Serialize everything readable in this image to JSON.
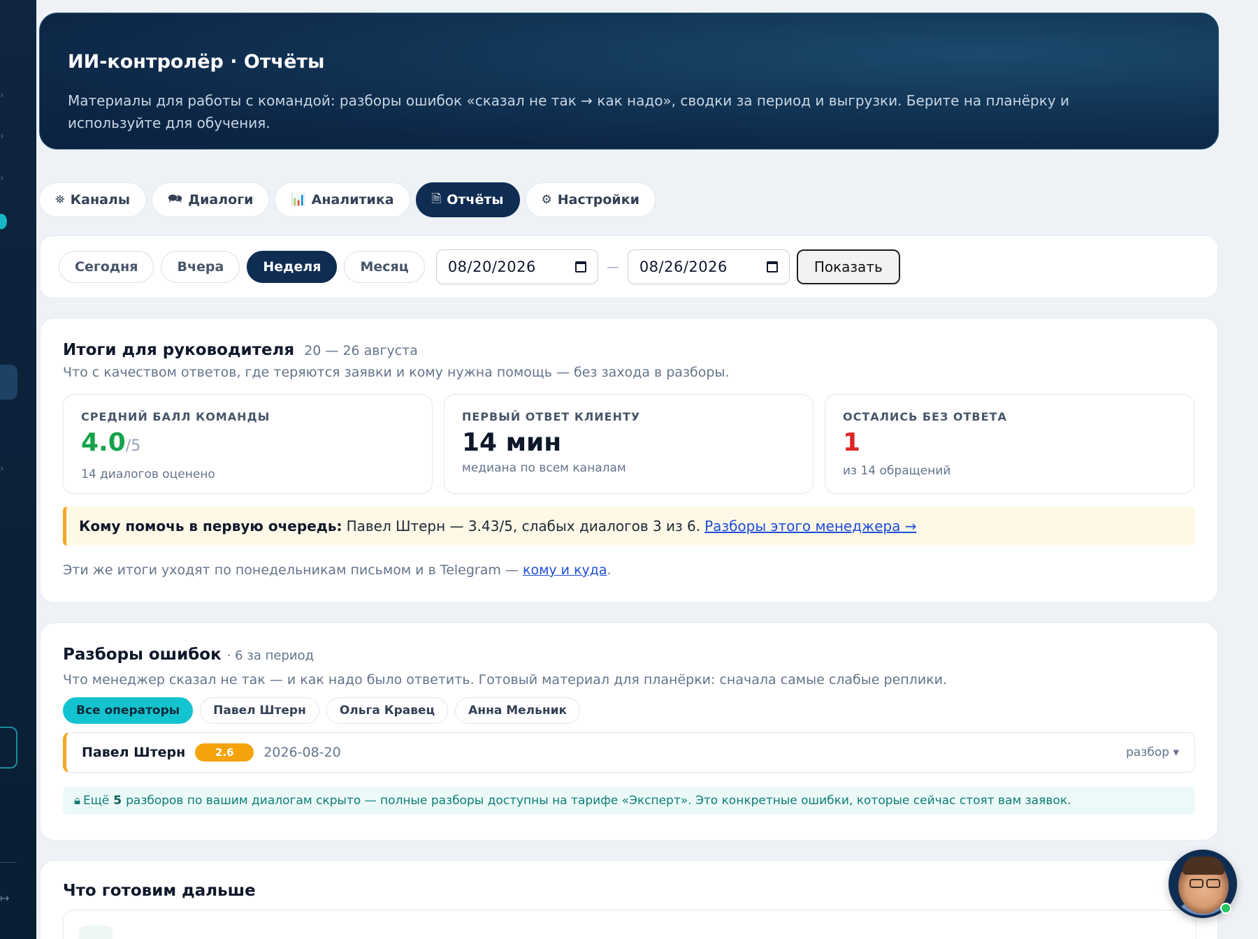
{
  "hero": {
    "title": "ИИ-контролёр · Отчёты",
    "description": "Материалы для работы с командой: разборы ошибок «сказал не так → как надо», сводки за период и выгрузки. Берите на планёрку и используйте для обучения."
  },
  "tabs": [
    {
      "label": "Каналы",
      "icon": "network-icon",
      "glyph": "⛯",
      "active": false
    },
    {
      "label": "Диалоги",
      "icon": "chat-icon",
      "glyph": "🗪",
      "active": false
    },
    {
      "label": "Аналитика",
      "icon": "bar-chart-icon",
      "glyph": "📊",
      "active": false
    },
    {
      "label": "Отчёты",
      "icon": "document-icon",
      "glyph": "🗎",
      "active": true
    },
    {
      "label": "Настройки",
      "icon": "gear-icon",
      "glyph": "⚙",
      "active": false
    }
  ],
  "filter": {
    "periods": [
      "Сегодня",
      "Вчера",
      "Неделя",
      "Месяц"
    ],
    "active_period": "Неделя",
    "date_from": "08/20/2026",
    "date_to": "08/26/2026",
    "separator": "—",
    "show_label": "Показать"
  },
  "summary": {
    "title": "Итоги для руководителя",
    "range": "20 — 26 августа",
    "description": "Что с качеством ответов, где теряются заявки и кому нужна помощь — без захода в разборы.",
    "kpis": [
      {
        "label": "СРЕДНИЙ БАЛЛ КОМАНДЫ",
        "value": "4.0",
        "suffix": "/5",
        "note": "14 диалогов оценено",
        "color": "#16a34a"
      },
      {
        "label": "ПЕРВЫЙ ОТВЕТ КЛИЕНТУ",
        "value": "14 мин",
        "suffix": "",
        "note": "медиана по всем каналам",
        "color": "#0f172a"
      },
      {
        "label": "ОСТАЛИСЬ БЕЗ ОТВЕТА",
        "value": "1",
        "suffix": "",
        "note": "из 14 обращений",
        "color": "#dc2626"
      }
    ],
    "help": {
      "lead": "Кому помочь в первую очередь:",
      "text": "Павел Штерн — 3.43/5, слабых диалогов 3 из 6.",
      "link": "Разборы этого менеджера →"
    },
    "footnote": {
      "text": "Эти же итоги уходят по понедельникам письмом и в Telegram —",
      "link": "кому и куда",
      "end": "."
    }
  },
  "errors": {
    "title": "Разборы ошибок",
    "count_note": "· 6 за период",
    "description": "Что менеджер сказал не так — и как надо было ответить. Готовый материал для планёрки: сначала самые слабые реплики.",
    "operators": [
      "Все операторы",
      "Павел Штерн",
      "Ольга Кравец",
      "Анна Мельник"
    ],
    "active_operator": "Все операторы",
    "rows": [
      {
        "name": "Павел Штерн",
        "score": "2.6",
        "date": "2026-08-20",
        "toggle": "разбор ▾"
      }
    ],
    "locked": {
      "prefix": "Ещё",
      "count": "5",
      "text": "разборов по вашим диалогам скрыто — полные разборы доступны на тарифе «Эксперт». Это конкретные ошибки, которые сейчас стоят вам заявок."
    }
  },
  "next": {
    "title": "Что готовим дальше"
  },
  "colors": {
    "accent": "#0f2d52",
    "cyan": "#13c3cf",
    "warning": "#f5a623",
    "success": "#16a34a",
    "danger": "#dc2626"
  }
}
